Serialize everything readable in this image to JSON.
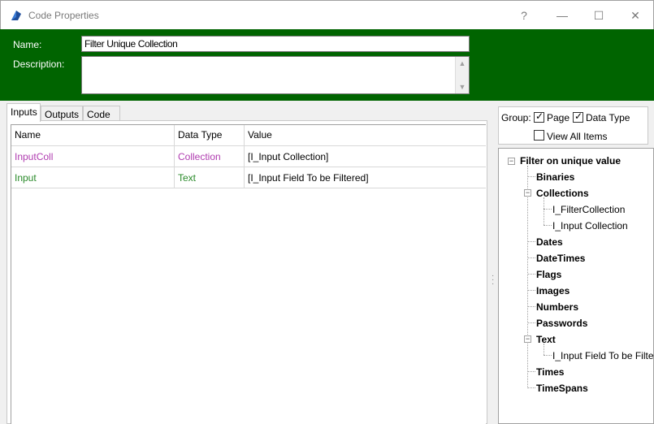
{
  "window": {
    "title": "Code Properties",
    "help_glyph": "?",
    "min_glyph": "—",
    "max_glyph": "☐",
    "close_glyph": "✕"
  },
  "header": {
    "name_label": "Name:",
    "name_value": "Filter Unique Collection",
    "description_label": "Description:",
    "description_value": "",
    "bg_color": "#006400"
  },
  "tabs": [
    {
      "label": "Inputs",
      "active": true
    },
    {
      "label": "Outputs",
      "active": false
    },
    {
      "label": "Code",
      "active": false
    }
  ],
  "grid": {
    "columns": [
      "Name",
      "Data Type",
      "Value"
    ],
    "rows": [
      {
        "name": "InputColl",
        "type": "Collection",
        "value": "[I_Input Collection]",
        "color": "#b03cb0"
      },
      {
        "name": "Input",
        "type": "Text",
        "value": "[I_Input Field To be Filtered]",
        "color": "#2a8a2a"
      }
    ]
  },
  "group": {
    "label": "Group:",
    "page_label": "Page",
    "page_checked": true,
    "type_label": "Data Type",
    "type_checked": true,
    "all_label": "View All Items",
    "all_checked": false
  },
  "tree": {
    "root": "Filter on unique value",
    "items": [
      {
        "label": "Binaries",
        "level": 1,
        "expandable": false
      },
      {
        "label": "Collections",
        "level": 1,
        "expandable": true
      },
      {
        "label": "I_FilterCollection",
        "level": 2,
        "expandable": false
      },
      {
        "label": "I_Input Collection",
        "level": 2,
        "expandable": false
      },
      {
        "label": "Dates",
        "level": 1,
        "expandable": false
      },
      {
        "label": "DateTimes",
        "level": 1,
        "expandable": false
      },
      {
        "label": "Flags",
        "level": 1,
        "expandable": false
      },
      {
        "label": "Images",
        "level": 1,
        "expandable": false
      },
      {
        "label": "Numbers",
        "level": 1,
        "expandable": false
      },
      {
        "label": "Passwords",
        "level": 1,
        "expandable": false
      },
      {
        "label": "Text",
        "level": 1,
        "expandable": true
      },
      {
        "label": "I_Input Field To be Filtered",
        "level": 2,
        "expandable": false
      },
      {
        "label": "Times",
        "level": 1,
        "expandable": false
      },
      {
        "label": "TimeSpans",
        "level": 1,
        "expandable": false
      }
    ]
  }
}
